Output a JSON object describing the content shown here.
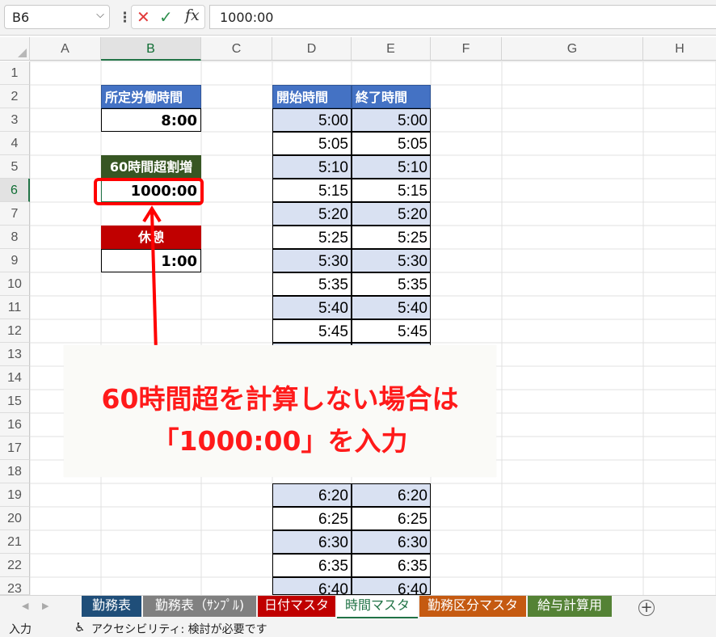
{
  "formula_bar": {
    "name_box": "B6",
    "cancel_icon": "✕",
    "enter_icon": "✓",
    "fx_label": "fx",
    "formula": "1000:00"
  },
  "columns": [
    "A",
    "B",
    "C",
    "D",
    "E",
    "F",
    "G",
    "H"
  ],
  "rows": [
    "1",
    "2",
    "3",
    "4",
    "5",
    "6",
    "7",
    "8",
    "9",
    "10",
    "11",
    "12",
    "13",
    "14",
    "15",
    "16",
    "17",
    "18",
    "19",
    "20",
    "21",
    "22",
    "23"
  ],
  "cells": {
    "b2": "所定労働時間",
    "b3": "8:00",
    "b5": "60時間超割増",
    "b6": "1000:00",
    "b8": "休憩",
    "b9": "1:00",
    "d2": "開始時間",
    "e2": "終了時間"
  },
  "time_table": [
    {
      "start": "5:00",
      "end": "5:00"
    },
    {
      "start": "5:05",
      "end": "5:05"
    },
    {
      "start": "5:10",
      "end": "5:10"
    },
    {
      "start": "5:15",
      "end": "5:15"
    },
    {
      "start": "5:20",
      "end": "5:20"
    },
    {
      "start": "5:25",
      "end": "5:25"
    },
    {
      "start": "5:30",
      "end": "5:30"
    },
    {
      "start": "5:35",
      "end": "5:35"
    },
    {
      "start": "5:40",
      "end": "5:40"
    },
    {
      "start": "5:45",
      "end": "5:45"
    }
  ],
  "time_table_lower": [
    {
      "start": "6:20",
      "end": "6:20"
    },
    {
      "start": "6:25",
      "end": "6:25"
    },
    {
      "start": "6:30",
      "end": "6:30"
    },
    {
      "start": "6:35",
      "end": "6:35"
    },
    {
      "start": "6:40",
      "end": "6:40"
    }
  ],
  "callout": {
    "line1": "60時間超を計算しない場合は",
    "line2": "「1000:00」を入力"
  },
  "sheet_tabs": [
    {
      "label": "勤務表",
      "color": "#1f4e79"
    },
    {
      "label": "勤務表（ｻﾝﾌﾟﾙ)",
      "color": "#808080"
    },
    {
      "label": "日付マスタ",
      "color": "#c00000"
    },
    {
      "label": "時間マスタ",
      "color": "#ffffff",
      "active": true
    },
    {
      "label": "勤務区分マスタ",
      "color": "#c55a11"
    },
    {
      "label": "給与計算用",
      "color": "#548235"
    }
  ],
  "add_sheet": "+",
  "status": {
    "mode": "入力",
    "accessibility": "アクセシビリティ: 検討が必要です"
  },
  "colors": {
    "accent": "#217346",
    "callout_text": "#ff1a1a",
    "highlight": "#ff0000"
  }
}
